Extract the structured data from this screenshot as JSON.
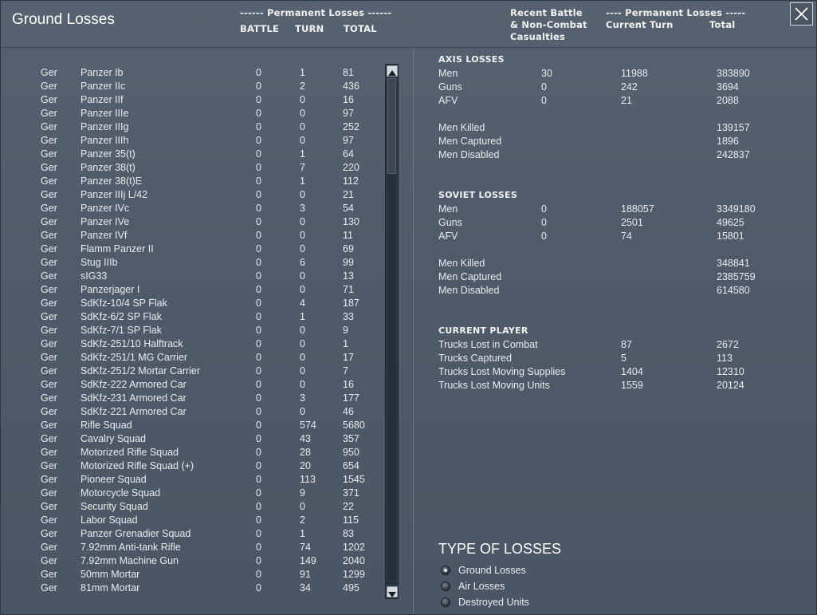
{
  "window": {
    "title": "Ground Losses"
  },
  "header": {
    "left_group": "------ Permanent Losses ------",
    "col_battle": "BATTLE",
    "col_turn": "TURN",
    "col_total": "TOTAL",
    "recent_line1": "Recent Battle",
    "recent_line2": "& Non-Combat",
    "recent_line3": "Casualties",
    "right_group": "---- Permanent Losses -----",
    "current_turn": "Current Turn",
    "total": "Total"
  },
  "losses": [
    {
      "nat": "Ger",
      "name": "Panzer Ib",
      "battle": "0",
      "turn": "1",
      "total": "81"
    },
    {
      "nat": "Ger",
      "name": "Panzer IIc",
      "battle": "0",
      "turn": "2",
      "total": "436"
    },
    {
      "nat": "Ger",
      "name": "Panzer IIf",
      "battle": "0",
      "turn": "0",
      "total": "16"
    },
    {
      "nat": "Ger",
      "name": "Panzer IIIe",
      "battle": "0",
      "turn": "0",
      "total": "97"
    },
    {
      "nat": "Ger",
      "name": "Panzer IIIg",
      "battle": "0",
      "turn": "0",
      "total": "252"
    },
    {
      "nat": "Ger",
      "name": "Panzer IIIh",
      "battle": "0",
      "turn": "0",
      "total": "97"
    },
    {
      "nat": "Ger",
      "name": "Panzer 35(t)",
      "battle": "0",
      "turn": "1",
      "total": "64"
    },
    {
      "nat": "Ger",
      "name": "Panzer 38(t)",
      "battle": "0",
      "turn": "7",
      "total": "220"
    },
    {
      "nat": "Ger",
      "name": "Panzer 38(t)E",
      "battle": "0",
      "turn": "1",
      "total": "112"
    },
    {
      "nat": "Ger",
      "name": "Panzer IIIj L/42",
      "battle": "0",
      "turn": "0",
      "total": "21"
    },
    {
      "nat": "Ger",
      "name": "Panzer IVc",
      "battle": "0",
      "turn": "3",
      "total": "54"
    },
    {
      "nat": "Ger",
      "name": "Panzer IVe",
      "battle": "0",
      "turn": "0",
      "total": "130"
    },
    {
      "nat": "Ger",
      "name": "Panzer IVf",
      "battle": "0",
      "turn": "0",
      "total": "11"
    },
    {
      "nat": "Ger",
      "name": "Flamm Panzer II",
      "battle": "0",
      "turn": "0",
      "total": "69"
    },
    {
      "nat": "Ger",
      "name": "Stug IIIb",
      "battle": "0",
      "turn": "6",
      "total": "99"
    },
    {
      "nat": "Ger",
      "name": "sIG33",
      "battle": "0",
      "turn": "0",
      "total": "13"
    },
    {
      "nat": "Ger",
      "name": "Panzerjager I",
      "battle": "0",
      "turn": "0",
      "total": "71"
    },
    {
      "nat": "Ger",
      "name": "SdKfz-10/4 SP Flak",
      "battle": "0",
      "turn": "4",
      "total": "187"
    },
    {
      "nat": "Ger",
      "name": "SdKfz-6/2 SP Flak",
      "battle": "0",
      "turn": "1",
      "total": "33"
    },
    {
      "nat": "Ger",
      "name": "SdKfz-7/1 SP Flak",
      "battle": "0",
      "turn": "0",
      "total": "9"
    },
    {
      "nat": "Ger",
      "name": "SdKfz-251/10 Halftrack",
      "battle": "0",
      "turn": "0",
      "total": "1"
    },
    {
      "nat": "Ger",
      "name": "SdKfz-251/1 MG Carrier",
      "battle": "0",
      "turn": "0",
      "total": "17"
    },
    {
      "nat": "Ger",
      "name": "SdKfz-251/2 Mortar Carrier",
      "battle": "0",
      "turn": "0",
      "total": "7"
    },
    {
      "nat": "Ger",
      "name": "SdKfz-222 Armored Car",
      "battle": "0",
      "turn": "0",
      "total": "16"
    },
    {
      "nat": "Ger",
      "name": "SdKfz-231 Armored Car",
      "battle": "0",
      "turn": "3",
      "total": "177"
    },
    {
      "nat": "Ger",
      "name": "SdKfz-221 Armored Car",
      "battle": "0",
      "turn": "0",
      "total": "46"
    },
    {
      "nat": "Ger",
      "name": "Rifle Squad",
      "battle": "0",
      "turn": "574",
      "total": "5680"
    },
    {
      "nat": "Ger",
      "name": "Cavalry Squad",
      "battle": "0",
      "turn": "43",
      "total": "357"
    },
    {
      "nat": "Ger",
      "name": "Motorized Rifle Squad",
      "battle": "0",
      "turn": "28",
      "total": "950"
    },
    {
      "nat": "Ger",
      "name": "Motorized Rifle Squad (+)",
      "battle": "0",
      "turn": "20",
      "total": "654"
    },
    {
      "nat": "Ger",
      "name": "Pioneer Squad",
      "battle": "0",
      "turn": "113",
      "total": "1545"
    },
    {
      "nat": "Ger",
      "name": "Motorcycle Squad",
      "battle": "0",
      "turn": "9",
      "total": "371"
    },
    {
      "nat": "Ger",
      "name": "Security Squad",
      "battle": "0",
      "turn": "0",
      "total": "22"
    },
    {
      "nat": "Ger",
      "name": "Labor Squad",
      "battle": "0",
      "turn": "2",
      "total": "115"
    },
    {
      "nat": "Ger",
      "name": "Panzer Grenadier Squad",
      "battle": "0",
      "turn": "1",
      "total": "83"
    },
    {
      "nat": "Ger",
      "name": "7.92mm Anti-tank Rifle",
      "battle": "0",
      "turn": "74",
      "total": "1202"
    },
    {
      "nat": "Ger",
      "name": "7.92mm Machine Gun",
      "battle": "0",
      "turn": "149",
      "total": "2040"
    },
    {
      "nat": "Ger",
      "name": "50mm Mortar",
      "battle": "0",
      "turn": "91",
      "total": "1299"
    },
    {
      "nat": "Ger",
      "name": "81mm Mortar",
      "battle": "0",
      "turn": "34",
      "total": "495"
    }
  ],
  "axis": {
    "heading": "AXIS LOSSES",
    "rows": [
      {
        "label": "Men",
        "recent": "30",
        "turn": "11988",
        "total": "383890"
      },
      {
        "label": "Guns",
        "recent": "0",
        "turn": "242",
        "total": "3694"
      },
      {
        "label": "AFV",
        "recent": "0",
        "turn": "21",
        "total": "2088"
      }
    ],
    "breakdown": [
      {
        "label": "Men Killed",
        "total": "139157"
      },
      {
        "label": "Men Captured",
        "total": "1896"
      },
      {
        "label": "Men Disabled",
        "total": "242837"
      }
    ]
  },
  "soviet": {
    "heading": "SOVIET LOSSES",
    "rows": [
      {
        "label": "Men",
        "recent": "0",
        "turn": "188057",
        "total": "3349180"
      },
      {
        "label": "Guns",
        "recent": "0",
        "turn": "2501",
        "total": "49625"
      },
      {
        "label": "AFV",
        "recent": "0",
        "turn": "74",
        "total": "15801"
      }
    ],
    "breakdown": [
      {
        "label": "Men Killed",
        "total": "348841"
      },
      {
        "label": "Men Captured",
        "total": "2385759"
      },
      {
        "label": "Men Disabled",
        "total": "614580"
      }
    ]
  },
  "player": {
    "heading": "CURRENT PLAYER",
    "rows": [
      {
        "label": "Trucks Lost in Combat",
        "turn": "87",
        "total": "2672"
      },
      {
        "label": "Trucks Captured",
        "turn": "5",
        "total": "113"
      },
      {
        "label": "Trucks Lost Moving Supplies",
        "turn": "1404",
        "total": "12310"
      },
      {
        "label": "Trucks Lost Moving Units",
        "turn": "1559",
        "total": "20124"
      }
    ]
  },
  "type_of_losses": {
    "title": "TYPE OF LOSSES",
    "options": [
      "Ground Losses",
      "Air Losses",
      "Destroyed Units"
    ],
    "selected": "Ground Losses"
  },
  "icons": {
    "close": "close-icon",
    "scroll_up": "arrow-up-icon",
    "scroll_down": "arrow-down-icon"
  }
}
